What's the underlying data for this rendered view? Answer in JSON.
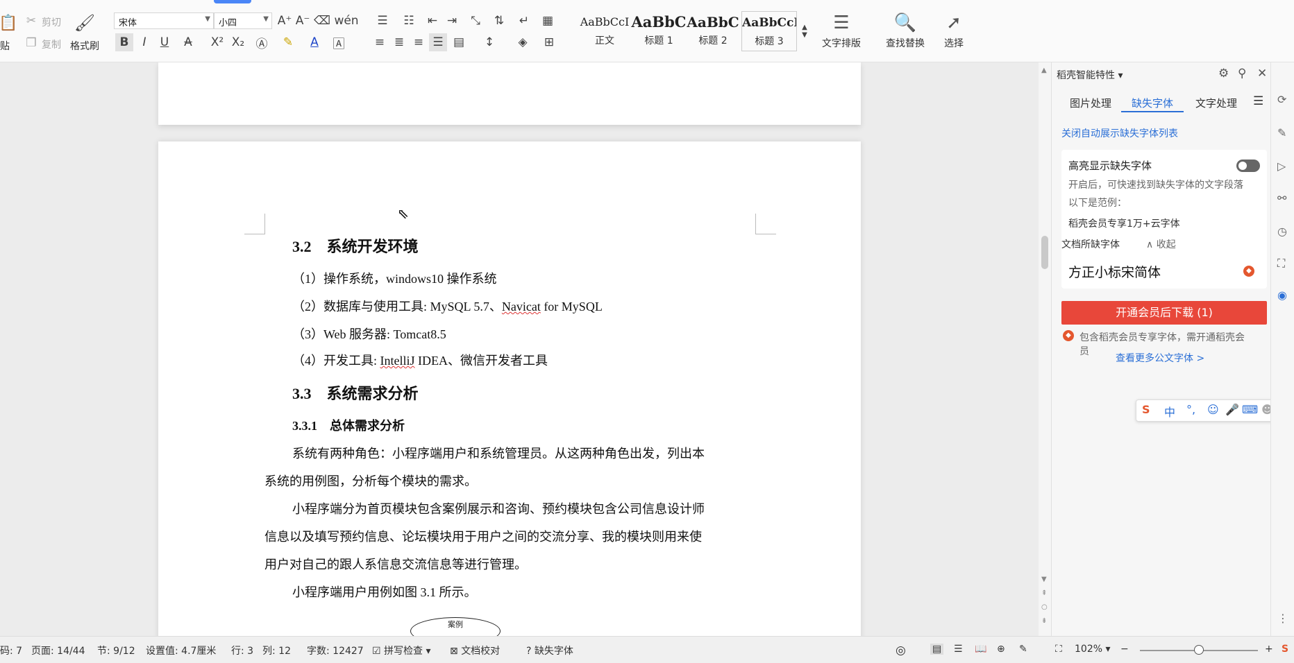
{
  "ribbon": {
    "clipboard": {
      "paste": "贴",
      "cut": "剪切",
      "copy": "复制",
      "format_painter": "格式刷"
    },
    "font_name": "宋体",
    "font_size": "小四",
    "styles": [
      {
        "preview": "AaBbCcI",
        "name": "正文"
      },
      {
        "preview": "AaBbC",
        "name": "标题 1"
      },
      {
        "preview": "AaBbC",
        "name": "标题 2"
      },
      {
        "preview": "AaBbCcI",
        "name": "标题 3"
      }
    ],
    "text_layout": "文字排版",
    "find_replace": "查找替换",
    "select": "选择"
  },
  "document": {
    "h_3_2": "3.2　系统开发环境",
    "env_1": "（1）操作系统，windows10 操作系统",
    "env_2a": "（2）数据库与使用工具: MySQL 5.7、",
    "env_2b": "Navicat",
    "env_2c": " for MySQL",
    "env_3": "（3）Web 服务器: Tomcat8.5",
    "env_4a": "（4）开发工具: ",
    "env_4b": "IntelliJ",
    "env_4c": " IDEA、微信开发者工具",
    "h_3_3": "3.3　系统需求分析",
    "h_3_3_1": "3.3.1　总体需求分析",
    "para1_l1": "系统有两种角色：小程序端用户和系统管理员。从这两种角色出发，列出本",
    "para1_l2": "系统的用例图，分析每个模块的需求。",
    "para2_l1": "小程序端分为首页模块包含案例展示和咨询、预约模块包含公司信息设计师",
    "para2_l2": "信息以及填写预约信息、论坛模块用于用户之间的交流分享、我的模块则用来使",
    "para2_l3": "用户对自己的跟人系信息交流信息等进行管理。",
    "para3": "小程序端用户用例如图 3.1 所示。",
    "diagram_label": "案例"
  },
  "panel": {
    "title": "稻壳智能特性",
    "tabs": [
      "图片处理",
      "缺失字体",
      "文字处理"
    ],
    "close_auto_link": "关闭自动展示缺失字体列表",
    "highlight_title": "高亮显示缺失字体",
    "highlight_desc": "开启后，可快速找到缺失字体的文字段落",
    "example_label": "以下是范例：",
    "example_value": "稻壳会员专享1万+云字体",
    "collapse": "收起",
    "missing_label": "文档所缺字体",
    "missing_font": "方正小标宋简体",
    "download_btn": "开通会员后下载 (1)",
    "member_note": "包含稻壳会员专享字体，需开通稻壳会员",
    "more_link": "查看更多公文字体 >"
  },
  "ime": {
    "mode": "中",
    "punct": "°,"
  },
  "status": {
    "page_code": "码: 7",
    "page": "页面: 14/44",
    "section": "节: 9/12",
    "setting": "设置值: 4.7厘米",
    "row": "行: 3",
    "col": "列: 12",
    "word_count": "字数: 12427",
    "spell_check": "拼写检查",
    "doc_proof": "文档校对",
    "missing_font": "缺失字体",
    "zoom": "102%"
  }
}
